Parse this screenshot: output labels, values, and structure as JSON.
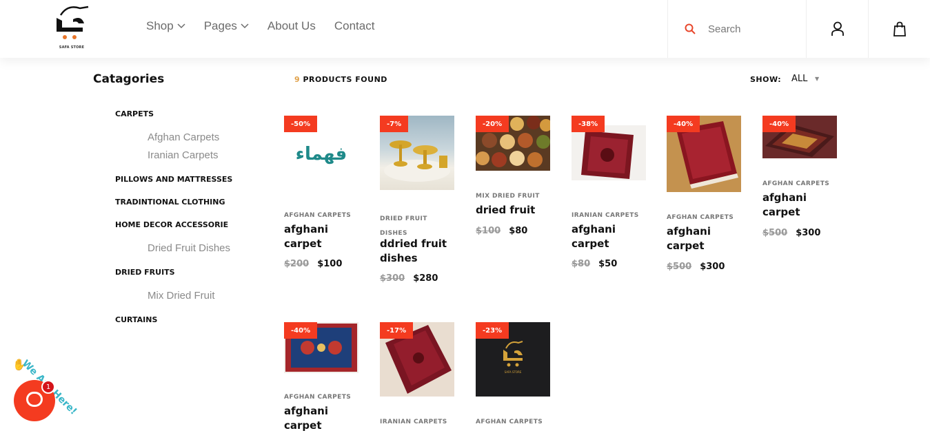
{
  "header": {
    "logo_text": "SAFA STORE",
    "nav": [
      {
        "label": "Shop",
        "dropdown": true
      },
      {
        "label": "Pages",
        "dropdown": true
      },
      {
        "label": "About Us",
        "dropdown": false
      },
      {
        "label": "Contact",
        "dropdown": false
      }
    ],
    "search_placeholder": "Search",
    "icons": {
      "search": "search-icon",
      "account": "user-icon",
      "cart": "shopping-bag-icon"
    }
  },
  "sidebar": {
    "title": "Catagories",
    "categories": [
      {
        "label": "CARPETS",
        "subs": [
          "Afghan Carpets",
          "Iranian Carpets"
        ]
      },
      {
        "label": "PILLOWS AND MATTRESSES",
        "subs": []
      },
      {
        "label": "TRADINTIONAL CLOTHING",
        "subs": []
      },
      {
        "label": "HOME DECOR ACCESSORIE",
        "subs": [
          "Dried Fruit Dishes"
        ]
      },
      {
        "label": "DRIED FRUITS",
        "subs": [
          "Mix Dried Fruit"
        ]
      },
      {
        "label": "CURTAINS",
        "subs": []
      }
    ]
  },
  "toolbar": {
    "count": "9",
    "found_label": "PRODUCTS FOUND",
    "show_label": "SHOW:",
    "show_value": "ALL"
  },
  "products": [
    {
      "badge": "-50%",
      "category": "AFGHAN CARPETS",
      "name": "afghani carpet",
      "old_price": "$200",
      "price": "$100",
      "image": "fahama-logo"
    },
    {
      "badge": "-7%",
      "category": "DRIED FRUIT DISHES",
      "name": "ddried fruit dishes",
      "old_price": "$300",
      "price": "$280",
      "image": "gold-dishes"
    },
    {
      "badge": "-20%",
      "category": "MIX DRIED FRUIT",
      "name": "dried fruit",
      "old_price": "$100",
      "price": "$80",
      "image": "dried-fruit-bowls"
    },
    {
      "badge": "-38%",
      "category": "IRANIAN CARPETS",
      "name": "afghani carpet",
      "old_price": "$80",
      "price": "$50",
      "image": "red-carpet"
    },
    {
      "badge": "-40%",
      "category": "AFGHAN CARPETS",
      "name": "afghani carpet",
      "old_price": "$500",
      "price": "$300",
      "image": "red-carpet-floor"
    },
    {
      "badge": "-40%",
      "category": "AFGHAN CARPETS",
      "name": "afghani carpet",
      "old_price": "$500",
      "price": "$300",
      "image": "brown-carpet"
    },
    {
      "badge": "-40%",
      "category": "AFGHAN CARPETS",
      "name": "afghani carpet",
      "old_price": "",
      "price": "",
      "image": "blue-carpet"
    },
    {
      "badge": "-17%",
      "category": "IRANIAN CARPETS",
      "name": "",
      "old_price": "",
      "price": "",
      "image": "red-carpet-2"
    },
    {
      "badge": "-23%",
      "category": "AFGHAN CARPETS",
      "name": "",
      "old_price": "",
      "price": "",
      "image": "safa-store-logo"
    }
  ],
  "chat": {
    "label": "We Are Here!",
    "unread": "1"
  },
  "colors": {
    "accent": "#f43b20",
    "count": "#e0a14a",
    "chat_text": "#39b6c8"
  }
}
